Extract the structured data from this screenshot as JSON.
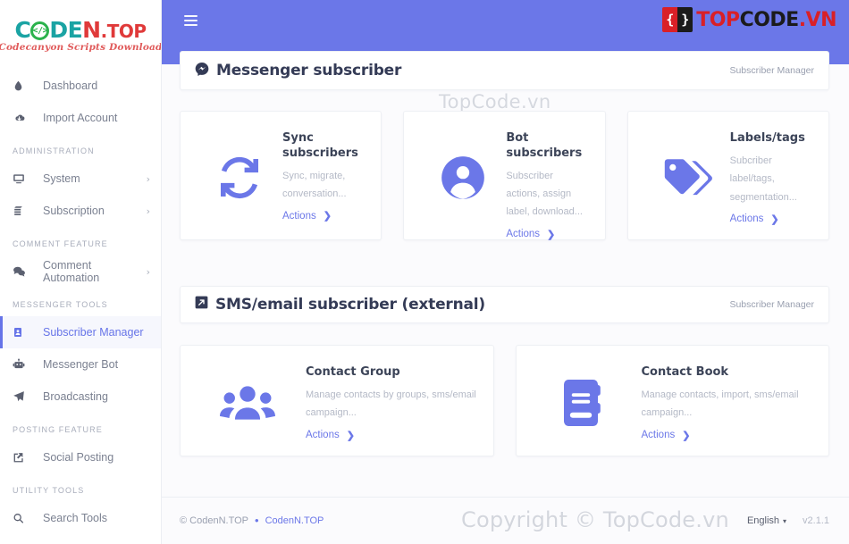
{
  "brand": {
    "logo_code": "CODE",
    "logo_name": "N",
    "logo_tld": ".TOP",
    "logo_bracket": "</>",
    "tagline": "Codecanyon Scripts Download"
  },
  "topbar": {
    "menu_icon": "hamburger-icon",
    "watermark_logo": {
      "left_glyph": "{",
      "right_glyph": "}",
      "text_1": "TOP",
      "text_2": "CODE",
      "text_3": ".VN"
    }
  },
  "sidebar": {
    "groups": [
      {
        "label": "",
        "items": [
          {
            "label": "Dashboard",
            "icon": "droplet-icon",
            "caret": ""
          },
          {
            "label": "Import Account",
            "icon": "cloud-download-icon",
            "caret": ""
          }
        ]
      },
      {
        "label": "ADMINISTRATION",
        "items": [
          {
            "label": "System",
            "icon": "desktop-icon",
            "caret": "›"
          },
          {
            "label": "Subscription",
            "icon": "layers-icon",
            "caret": "›"
          }
        ]
      },
      {
        "label": "COMMENT FEATURE",
        "items": [
          {
            "label": "Comment Automation",
            "icon": "comments-icon",
            "caret": "›"
          }
        ]
      },
      {
        "label": "MESSENGER TOOLS",
        "items": [
          {
            "label": "Subscriber Manager",
            "icon": "id-card-icon",
            "caret": "",
            "active": true
          },
          {
            "label": "Messenger Bot",
            "icon": "robot-icon",
            "caret": ""
          },
          {
            "label": "Broadcasting",
            "icon": "paper-plane-icon",
            "caret": ""
          }
        ]
      },
      {
        "label": "POSTING FEATURE",
        "items": [
          {
            "label": "Social Posting",
            "icon": "share-square-icon",
            "caret": ""
          }
        ]
      },
      {
        "label": "UTILITY TOOLS",
        "items": [
          {
            "label": "Search Tools",
            "icon": "search-icon",
            "caret": ""
          }
        ]
      }
    ]
  },
  "page": {
    "title": "Messenger subscriber",
    "title_icon": "messenger-icon",
    "breadcrumb": "Subscriber Manager",
    "watermark": "TopCode.vn"
  },
  "messenger_cards": [
    {
      "title": "Sync subscribers",
      "desc": "Sync, migrate, conversation...",
      "action": "Actions",
      "chevron": "❯",
      "icon": "sync-icon"
    },
    {
      "title": "Bot subscribers",
      "desc": "Subscriber actions, assign label, download...",
      "action": "Actions",
      "chevron": "❯",
      "icon": "user-circle-icon"
    },
    {
      "title": "Labels/tags",
      "desc": "Subcriber label/tags, segmentation...",
      "action": "Actions",
      "chevron": "❯",
      "icon": "tags-icon"
    }
  ],
  "external_section": {
    "title": "SMS/email subscriber (external)",
    "title_icon": "external-link-icon",
    "breadcrumb": "Subscriber Manager"
  },
  "external_cards": [
    {
      "title": "Contact Group",
      "desc": "Manage contacts by groups, sms/email campaign...",
      "action": "Actions",
      "chevron": "❯",
      "icon": "users-icon"
    },
    {
      "title": "Contact Book",
      "desc": "Manage contacts, import, sms/email campaign...",
      "action": "Actions",
      "chevron": "❯",
      "icon": "address-book-icon"
    }
  ],
  "footer": {
    "copyright": "© CodenN.TOP",
    "separator": "•",
    "link": "CodenN.TOP",
    "language": "English",
    "language_caret": "▾",
    "version": "v2.1.1",
    "watermark": "Copyright © TopCode.vn"
  },
  "colors": {
    "accent": "#6b77e8",
    "header": "#6b77e8",
    "title": "#343b56",
    "muted": "#b4b9c6",
    "brand_teal": "#1aa3a3",
    "brand_red": "#e03a3a",
    "brand_green": "#2bb24c"
  }
}
